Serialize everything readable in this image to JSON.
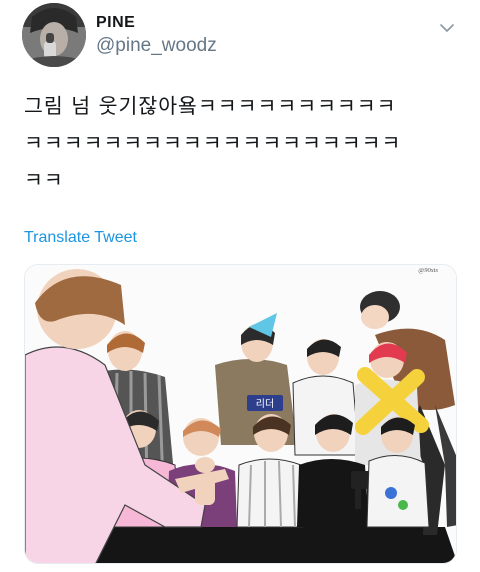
{
  "tweet": {
    "display_name": "PINE",
    "handle": "@pine_woodz",
    "text_lines": [
      "그림 넘 웃기잖아욬ㅋㅋㅋㅋㅋㅋㅋㅋㅋㅋ",
      "ㅋㅋㅋㅋㅋㅋㅋㅋㅋㅋㅋㅋㅋㅋㅋㅋㅋㅋㅋ",
      "ㅋㅋ"
    ],
    "translate_label": "Translate Tweet"
  },
  "media": {
    "badge_text": "리더",
    "watermark": "@90xts"
  },
  "icons": {
    "menu": "chevron-down-icon",
    "avatar": "user-avatar"
  },
  "colors": {
    "link": "#1b95e0",
    "handle": "#657786",
    "text": "#14171a"
  }
}
